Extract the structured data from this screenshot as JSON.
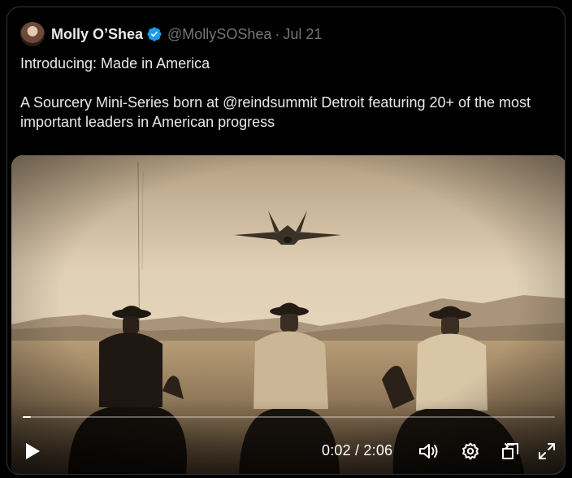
{
  "tweet": {
    "author_name": "Molly O’Shea",
    "handle": "@MollySOShea",
    "separator": "·",
    "date": "Jul 21",
    "line1": "Introducing: Made in America",
    "line2": "A Sourcery Mini-Series born at @reindsummit Detroit featuring 20+ of the most important leaders in American progress"
  },
  "video": {
    "current_time": "0:02",
    "duration": "2:06",
    "time_display": "0:02 / 2:06",
    "progress_fraction": 0.016
  },
  "icons": {
    "verified": "verified-badge-icon",
    "play": "play-icon",
    "volume": "volume-icon",
    "settings": "gear-icon",
    "pip": "picture-in-picture-icon",
    "fullscreen": "fullscreen-icon"
  },
  "colors": {
    "background": "#000000",
    "text": "#e7e9ea",
    "muted": "#71767b",
    "verified": "#1d9bf0"
  }
}
